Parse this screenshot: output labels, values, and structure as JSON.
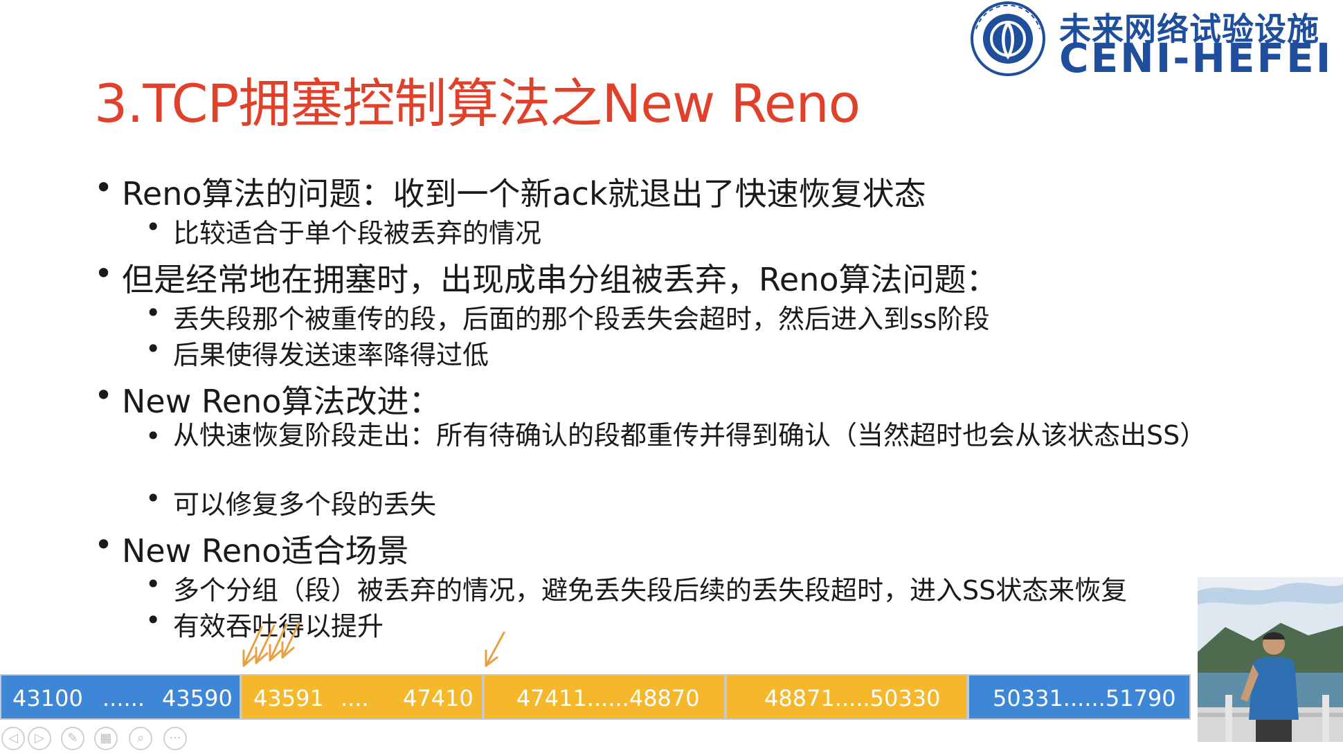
{
  "logo": {
    "name_cn": "未来网络试验设施",
    "name_en": "CENI-HEFEI",
    "emblem_icon": "ceni-emblem-icon",
    "brand_color": "#1f4e9c"
  },
  "slide": {
    "title": "3.TCP拥塞控制算法之New Reno",
    "title_color": "#e0412a",
    "bullets": [
      {
        "text": "Reno算法的问题：收到一个新ack就退出了快速恢复状态",
        "sub": [
          "比较适合于单个段被丢弃的情况"
        ]
      },
      {
        "text": "但是经常地在拥塞时，出现成串分组被丢弃，Reno算法问题：",
        "sub": [
          "丢失段那个被重传的段，后面的那个段丢失会超时，然后进入到ss阶段",
          "后果使得发送速率降得过低"
        ]
      },
      {
        "text": "New Reno算法改进：",
        "sub": [
          "从快速恢复阶段走出：所有待确认的段都重传并得到确认（当然超时也会从该状态出SS）",
          "可以修复多个段的丢失"
        ]
      },
      {
        "text": "New Reno适合场景",
        "sub": [
          "多个分组（段）被丢弃的情况，避免丢失段后续的丢失段超时，进入SS状态来恢复",
          "有效吞吐得以提升"
        ]
      }
    ]
  },
  "sequence_bar": {
    "colors": {
      "blue": "#3e87d6",
      "gold": "#f4b82a"
    },
    "segments": [
      {
        "parts": [
          "43100",
          "......",
          "43590"
        ]
      },
      {
        "parts": [
          "43591",
          "....",
          "47410"
        ]
      },
      {
        "parts": [
          "47411......48870"
        ]
      },
      {
        "parts": [
          "48871.....50330"
        ]
      },
      {
        "parts": [
          "50331......51790"
        ]
      }
    ]
  },
  "player_controls": [
    "prev-icon",
    "play-icon",
    "pen-icon",
    "grid-icon",
    "zoom-icon",
    "more-icon"
  ],
  "player_glyphs": [
    "◁",
    "▷",
    "✎",
    "▦",
    "⌕",
    "···"
  ]
}
